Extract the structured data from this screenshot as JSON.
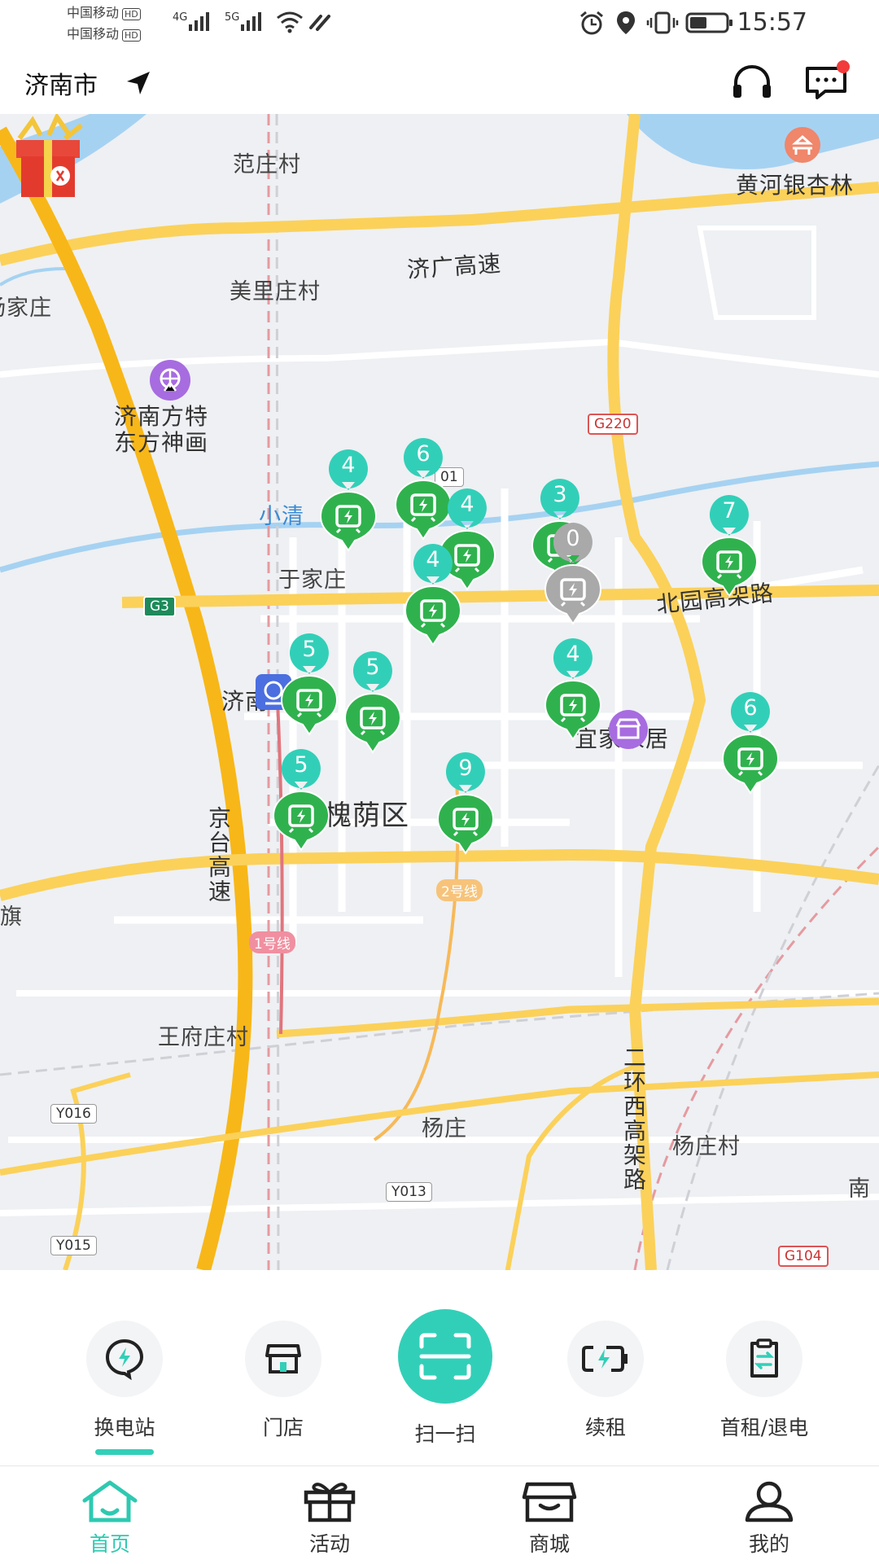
{
  "status_bar": {
    "carrier1": "中国移动",
    "carrier2": "中国移动",
    "hd": "HD",
    "net1": "4G",
    "net2": "5G",
    "time": "15:57"
  },
  "header": {
    "city": "济南市"
  },
  "map": {
    "places": {
      "fanzhuang": "范庄村",
      "huanghe": "黄河银杏林",
      "meili": "美里庄村",
      "yangjia": "杨家庄",
      "jiguang": "济广高速",
      "fangte1": "济南方特",
      "fangte2": "东方神画",
      "xiaoqing": "小清",
      "yujia": "于家庄",
      "beiyuan": "北园高架路",
      "jinan_station": "济南",
      "yijia": "宜家家居",
      "huaiyin": "槐荫区",
      "jingtai": "京台高速",
      "qi": "旗",
      "wangfu": "王府庄村",
      "yangzhuang": "杨庄",
      "yangzhuangcun": "杨庄村",
      "erhuan": "二环西高架路",
      "nan": "南"
    },
    "road_badges": {
      "g220": "G220",
      "g3": "G3",
      "r501": "01",
      "y016": "Y016",
      "y013": "Y013",
      "y015": "Y015",
      "line1": "1号线",
      "line2": "2号线",
      "g104": "G104"
    },
    "stations": [
      {
        "count": "4",
        "status": "available"
      },
      {
        "count": "6",
        "status": "available"
      },
      {
        "count": "4",
        "status": "available"
      },
      {
        "count": "3",
        "status": "available"
      },
      {
        "count": "0",
        "status": "empty"
      },
      {
        "count": "7",
        "status": "available"
      },
      {
        "count": "4",
        "status": "available"
      },
      {
        "count": "5",
        "status": "available"
      },
      {
        "count": "5",
        "status": "available"
      },
      {
        "count": "4",
        "status": "available"
      },
      {
        "count": "6",
        "status": "available"
      },
      {
        "count": "5",
        "status": "available"
      },
      {
        "count": "9",
        "status": "available"
      }
    ]
  },
  "quick_actions": {
    "swap_station": "换电站",
    "store": "门店",
    "scan": "扫一扫",
    "renew": "续租",
    "first_rent": "首租/退电"
  },
  "tabs": {
    "home": "首页",
    "activity": "活动",
    "mall": "商城",
    "mine": "我的"
  },
  "colors": {
    "accent": "#32cfb8",
    "station_green": "#2fb24e",
    "station_teal": "#32cfb8",
    "empty_gray": "#a9a9a9"
  }
}
